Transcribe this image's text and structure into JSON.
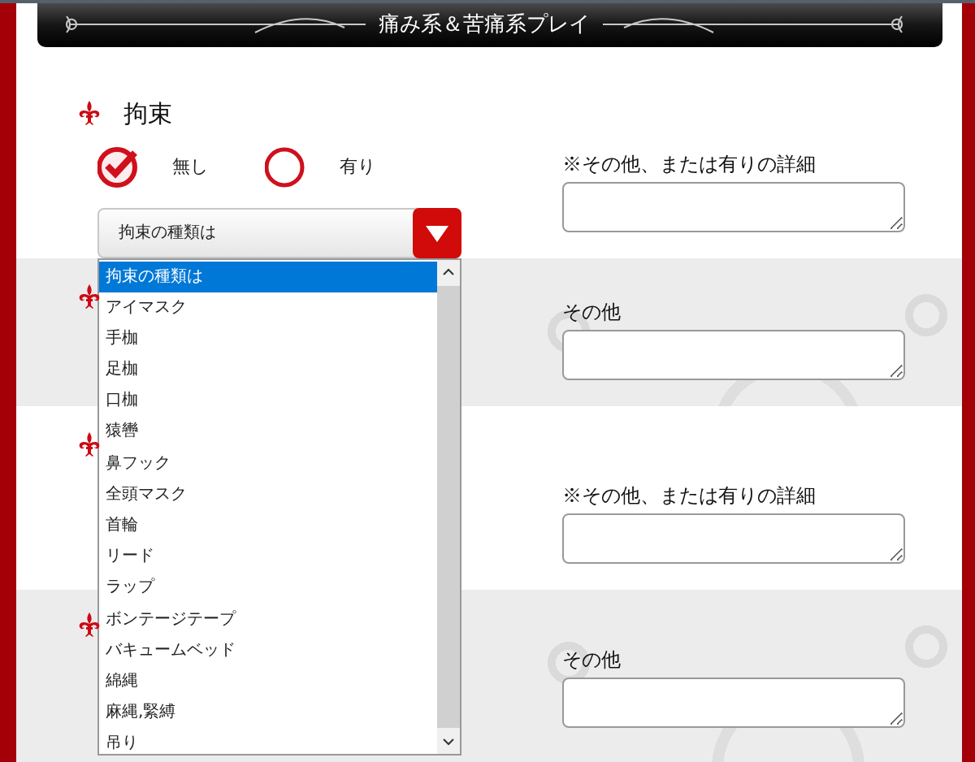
{
  "header": {
    "title": "痛み系＆苦痛系プレイ"
  },
  "sections": [
    {
      "title": "拘束",
      "options": [
        {
          "label": "無し",
          "selected": true
        },
        {
          "label": "有り",
          "selected": false
        }
      ],
      "select": {
        "value": "拘束の種類は",
        "expanded": true,
        "options": [
          {
            "label": "拘束の種類は",
            "selected": true
          },
          {
            "label": "アイマスク",
            "selected": false
          },
          {
            "label": "手枷",
            "selected": false
          },
          {
            "label": "足枷",
            "selected": false
          },
          {
            "label": "口枷",
            "selected": false
          },
          {
            "label": "猿轡",
            "selected": false
          },
          {
            "label": "鼻フック",
            "selected": false
          },
          {
            "label": "全頭マスク",
            "selected": false
          },
          {
            "label": "首輪",
            "selected": false
          },
          {
            "label": "リード",
            "selected": false
          },
          {
            "label": "ラップ",
            "selected": false
          },
          {
            "label": "ボンテージテープ",
            "selected": false
          },
          {
            "label": "バキュームベッド",
            "selected": false
          },
          {
            "label": "綿縄",
            "selected": false
          },
          {
            "label": "麻縄,緊縛",
            "selected": false
          },
          {
            "label": "吊り",
            "selected": false
          }
        ]
      },
      "detail_label": "※その他、または有りの詳細"
    },
    {
      "detail_label": "その他"
    },
    {
      "detail_label": "※その他、または有りの詳細"
    },
    {
      "detail_label": "その他"
    }
  ]
}
